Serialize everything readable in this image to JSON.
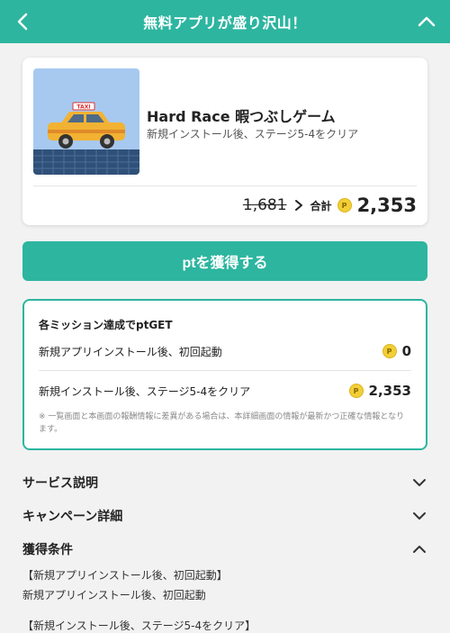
{
  "header": {
    "title": "無料アプリが盛り沢山！"
  },
  "app": {
    "name": "Hard Race 暇つぶしゲーム",
    "description": "新規インストール後、ステージ5‐4をクリア",
    "taxi_sign": "TAXI"
  },
  "price": {
    "old": "1,681",
    "total_label": "合計",
    "coin_symbol": "P",
    "total": "2,353"
  },
  "cta": {
    "label": "ptを獲得する"
  },
  "missions": {
    "heading": "各ミッション達成でptGET",
    "items": [
      {
        "label": "新規アプリインストール後、初回起動",
        "points": "0"
      },
      {
        "label": "新規インストール後、ステージ5‐4をクリア",
        "points": "2,353"
      }
    ],
    "note": "※ 一覧画面と本画面の報酬情報に差異がある場合は、本詳細画面の情報が最新かつ正確な情報となります。"
  },
  "sections": [
    {
      "label": "サービス説明",
      "state": "collapsed"
    },
    {
      "label": "キャンペーン詳細",
      "state": "collapsed"
    },
    {
      "label": "獲得条件",
      "state": "expanded"
    }
  ],
  "conditions": [
    "【新規アプリインストール後、初回起動】",
    "新規アプリインストール後、初回起動",
    "【新規インストール後、ステージ5‐4をクリア】"
  ],
  "colors": {
    "accent": "#2db5a0",
    "coin": "#f2cf36",
    "taxi": "#f2b233"
  }
}
